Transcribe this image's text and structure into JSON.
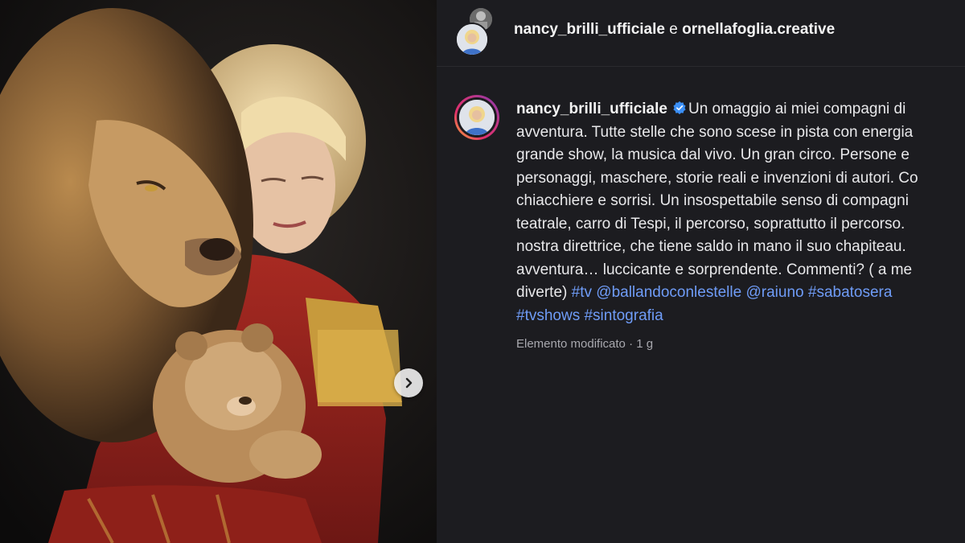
{
  "header": {
    "user1": "nancy_brilli_ufficiale",
    "separator": "e",
    "user2": "ornellafoglia.creative"
  },
  "post": {
    "username": "nancy_brilli_ufficiale",
    "first_line_text": "Un omaggio ai miei compagni di",
    "caption_lines": [
      "avventura. Tutte stelle che sono scese in pista con energia",
      "grande show, la musica dal vivo. Un gran circo. Persone e",
      "personaggi, maschere, storie reali e invenzioni di autori. Co",
      "chiacchiere e sorrisi. Un insospettabile senso di compagni",
      "teatrale, carro di Tespi, il percorso, soprattutto il percorso.",
      "nostra direttrice, che tiene saldo in mano il suo chapiteau.",
      "avventura… luccicante e sorprendente. Commenti? ( a me"
    ],
    "last_line_prefix": "diverte)",
    "hashtags_line1": [
      "#tv",
      "@ballandoconlestelle",
      "@raiuno",
      "#sabatosera"
    ],
    "hashtags_line2": [
      "#tvshows",
      "#sintografia"
    ],
    "meta": "Elemento modificato · 1 g"
  },
  "colors": {
    "background": "#1c1c20",
    "link": "#6f9cf7",
    "verified": "#3b8ff6"
  },
  "icons": {
    "next": "chevron-right-icon",
    "verified": "verified-badge-icon"
  }
}
